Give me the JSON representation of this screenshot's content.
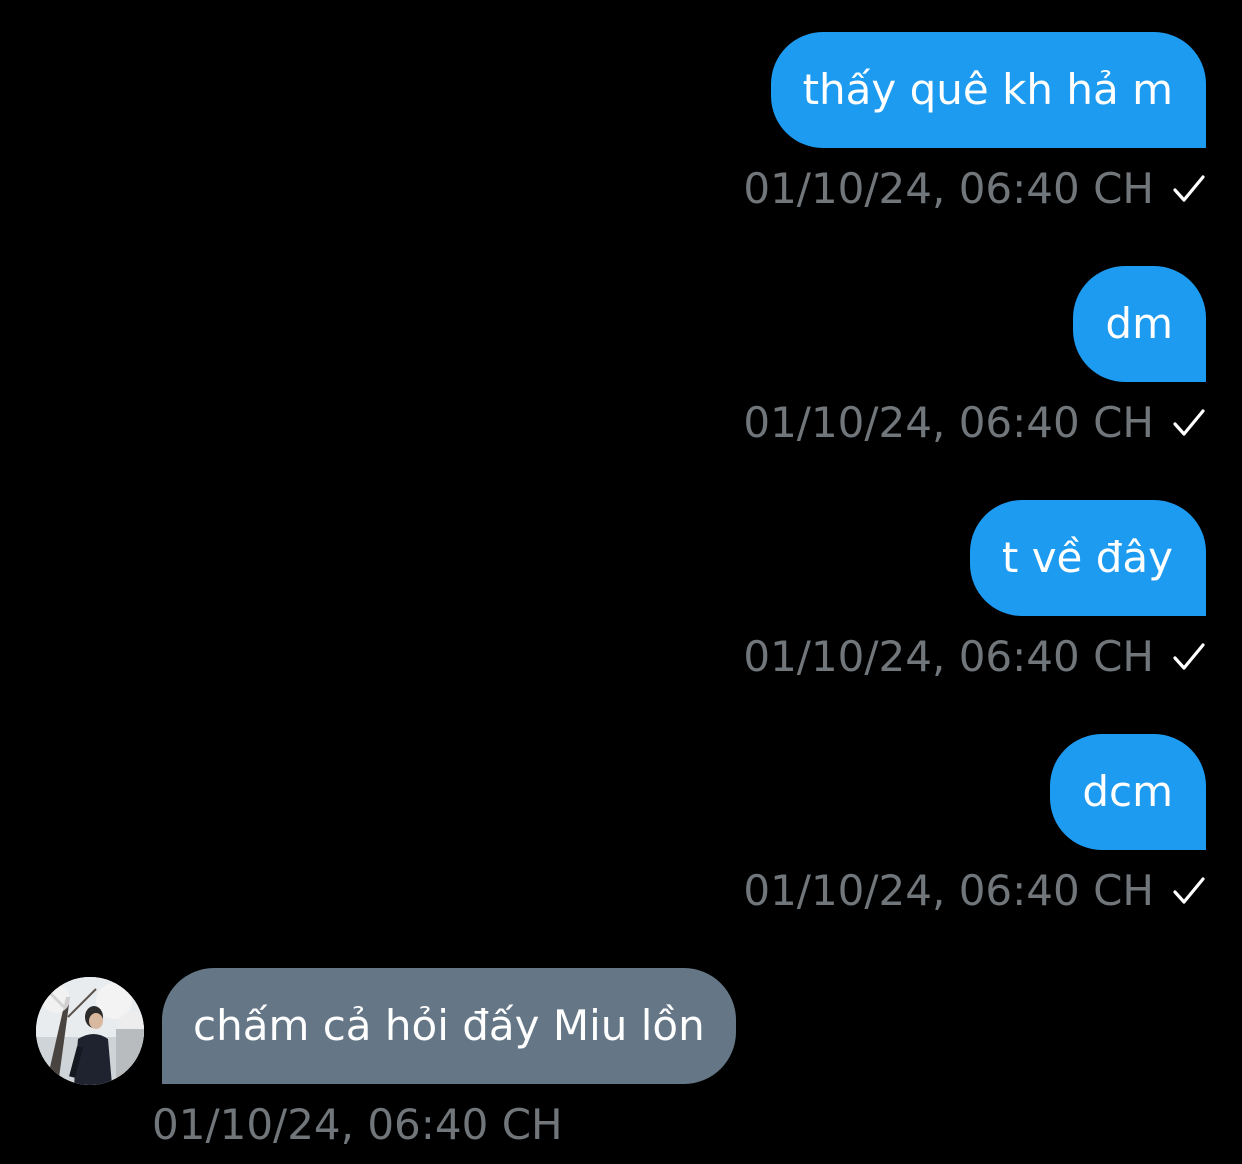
{
  "colors": {
    "background": "#000000",
    "outgoing_bubble": "#1d9bf0",
    "incoming_bubble": "#657786",
    "timestamp": "#71767b",
    "text": "#ffffff"
  },
  "messages": [
    {
      "direction": "outgoing",
      "text": "thấy quê kh hả m",
      "timestamp": "01/10/24, 06:40 CH",
      "status_icon": "check-icon"
    },
    {
      "direction": "outgoing",
      "text": "dm",
      "timestamp": "01/10/24, 06:40 CH",
      "status_icon": "check-icon"
    },
    {
      "direction": "outgoing",
      "text": "t về đây",
      "timestamp": "01/10/24, 06:40 CH",
      "status_icon": "check-icon"
    },
    {
      "direction": "outgoing",
      "text": "dcm",
      "timestamp": "01/10/24, 06:40 CH",
      "status_icon": "check-icon"
    },
    {
      "direction": "incoming",
      "text": "chấm cả hỏi đấy Miu lồn",
      "timestamp": "01/10/24, 06:40 CH",
      "avatar_icon": "avatar"
    }
  ]
}
